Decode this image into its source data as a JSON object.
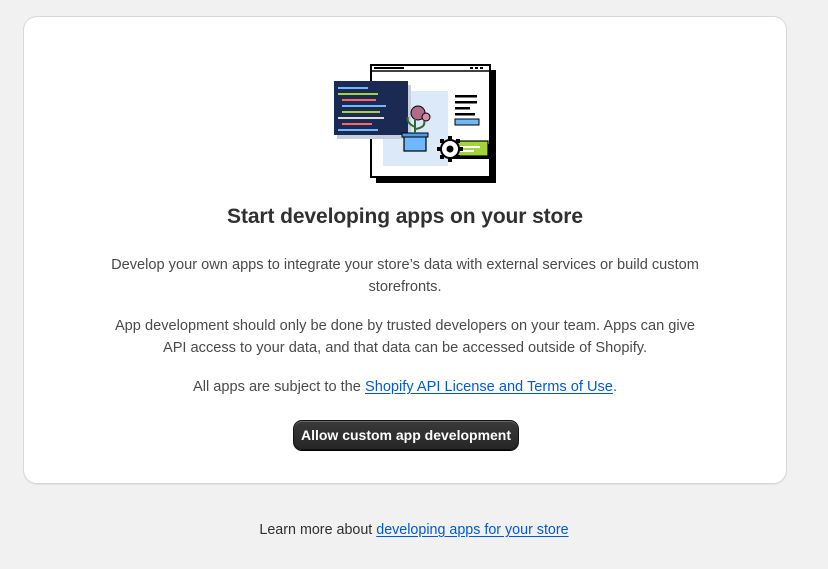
{
  "card": {
    "title": "Start developing apps on your store",
    "paragraph_1": "Develop your own apps to integrate your store’s data with external services or build custom storefronts.",
    "paragraph_2": "App development should only be done by trusted developers on your team. Apps can give API access to your data, and that data can be accessed outside of Shopify.",
    "terms_prefix": "All apps are subject to the ",
    "terms_link": "Shopify API License and Terms of Use",
    "terms_suffix": ".",
    "button_label": "Allow custom app development"
  },
  "footer": {
    "prefix": "Learn more about ",
    "link": "developing apps for your store"
  },
  "colors": {
    "page_bg": "#f1f1f1",
    "card_bg": "#ffffff",
    "link": "#005bd3",
    "button_bg": "#303030",
    "illustration_accent_blue": "#6fb7ff",
    "illustration_accent_green": "#a4d23b",
    "illustration_code_bg": "#1a2a52"
  },
  "icons": {
    "illustration": "app-development-illustration",
    "gear": "gear-icon",
    "plant": "potted-plant-icon"
  }
}
